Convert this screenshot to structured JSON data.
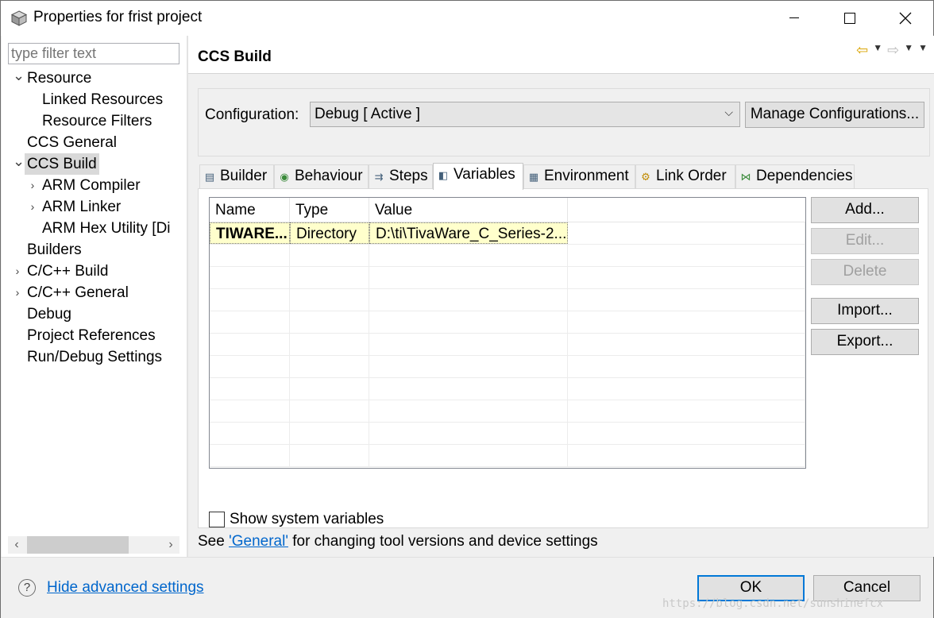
{
  "window": {
    "title": "Properties for frist project",
    "controls": {
      "minimize": "—",
      "maximize": "☐",
      "close": "✕"
    }
  },
  "left_pane": {
    "filter_placeholder": "type filter text",
    "tree": [
      {
        "label": "Resource",
        "twisty": "expanded",
        "level": 0
      },
      {
        "label": "Linked Resources",
        "twisty": "none",
        "level": 1
      },
      {
        "label": "Resource Filters",
        "twisty": "none",
        "level": 1
      },
      {
        "label": "CCS General",
        "twisty": "none",
        "level": 0
      },
      {
        "label": "CCS Build",
        "twisty": "expanded",
        "level": 0,
        "selected": true
      },
      {
        "label": "ARM Compiler",
        "twisty": "collapsed",
        "level": 1
      },
      {
        "label": "ARM Linker",
        "twisty": "collapsed",
        "level": 1
      },
      {
        "label": "ARM Hex Utility  [Di",
        "twisty": "none",
        "level": 1
      },
      {
        "label": "Builders",
        "twisty": "none",
        "level": 0
      },
      {
        "label": "C/C++ Build",
        "twisty": "collapsed",
        "level": 0
      },
      {
        "label": "C/C++ General",
        "twisty": "collapsed",
        "level": 0
      },
      {
        "label": "Debug",
        "twisty": "none",
        "level": 0
      },
      {
        "label": "Project References",
        "twisty": "none",
        "level": 0
      },
      {
        "label": "Run/Debug Settings",
        "twisty": "none",
        "level": 0
      }
    ],
    "scroll_left": "‹",
    "scroll_right": "›"
  },
  "right_pane": {
    "title": "CCS Build",
    "config_label": "Configuration:",
    "config_value": "Debug  [ Active ]",
    "manage_button": "Manage Configurations...",
    "tabs": [
      {
        "label": "Builder",
        "icon": "builder-icon",
        "glyph": "▤"
      },
      {
        "label": "Behaviour",
        "icon": "behaviour-icon",
        "glyph": "◉"
      },
      {
        "label": "Steps",
        "icon": "steps-icon",
        "glyph": "⇉"
      },
      {
        "label": "Variables",
        "icon": "variables-icon",
        "glyph": "◧",
        "active": true
      },
      {
        "label": "Environment",
        "icon": "environment-icon",
        "glyph": "▦"
      },
      {
        "label": "Link Order",
        "icon": "link-order-icon",
        "glyph": "⚙"
      },
      {
        "label": "Dependencies",
        "icon": "dependencies-icon",
        "glyph": "⋈"
      }
    ],
    "table": {
      "columns": [
        "Name",
        "Type",
        "Value"
      ],
      "rows": [
        {
          "name": "TIWARE...",
          "type": "Directory",
          "value": "D:\\ti\\TivaWare_C_Series-2...."
        }
      ]
    },
    "buttons": {
      "add": "Add...",
      "edit": "Edit...",
      "delete": "Delete",
      "import": "Import...",
      "export": "Export..."
    },
    "show_system_variables": "Show system variables",
    "info_prefix": "See ",
    "info_link": "'General'",
    "info_suffix": " for changing tool versions and device settings"
  },
  "footer": {
    "help": "?",
    "hide_advanced": "Hide advanced settings",
    "ok": "OK",
    "cancel": "Cancel",
    "watermark": "https://blog.csdn.net/sunshinefcx"
  },
  "colors": {
    "accent": "#0078d7",
    "link": "#0066cc",
    "selected_row": "#ffffcc",
    "tree_selected": "#d9d9d9"
  }
}
